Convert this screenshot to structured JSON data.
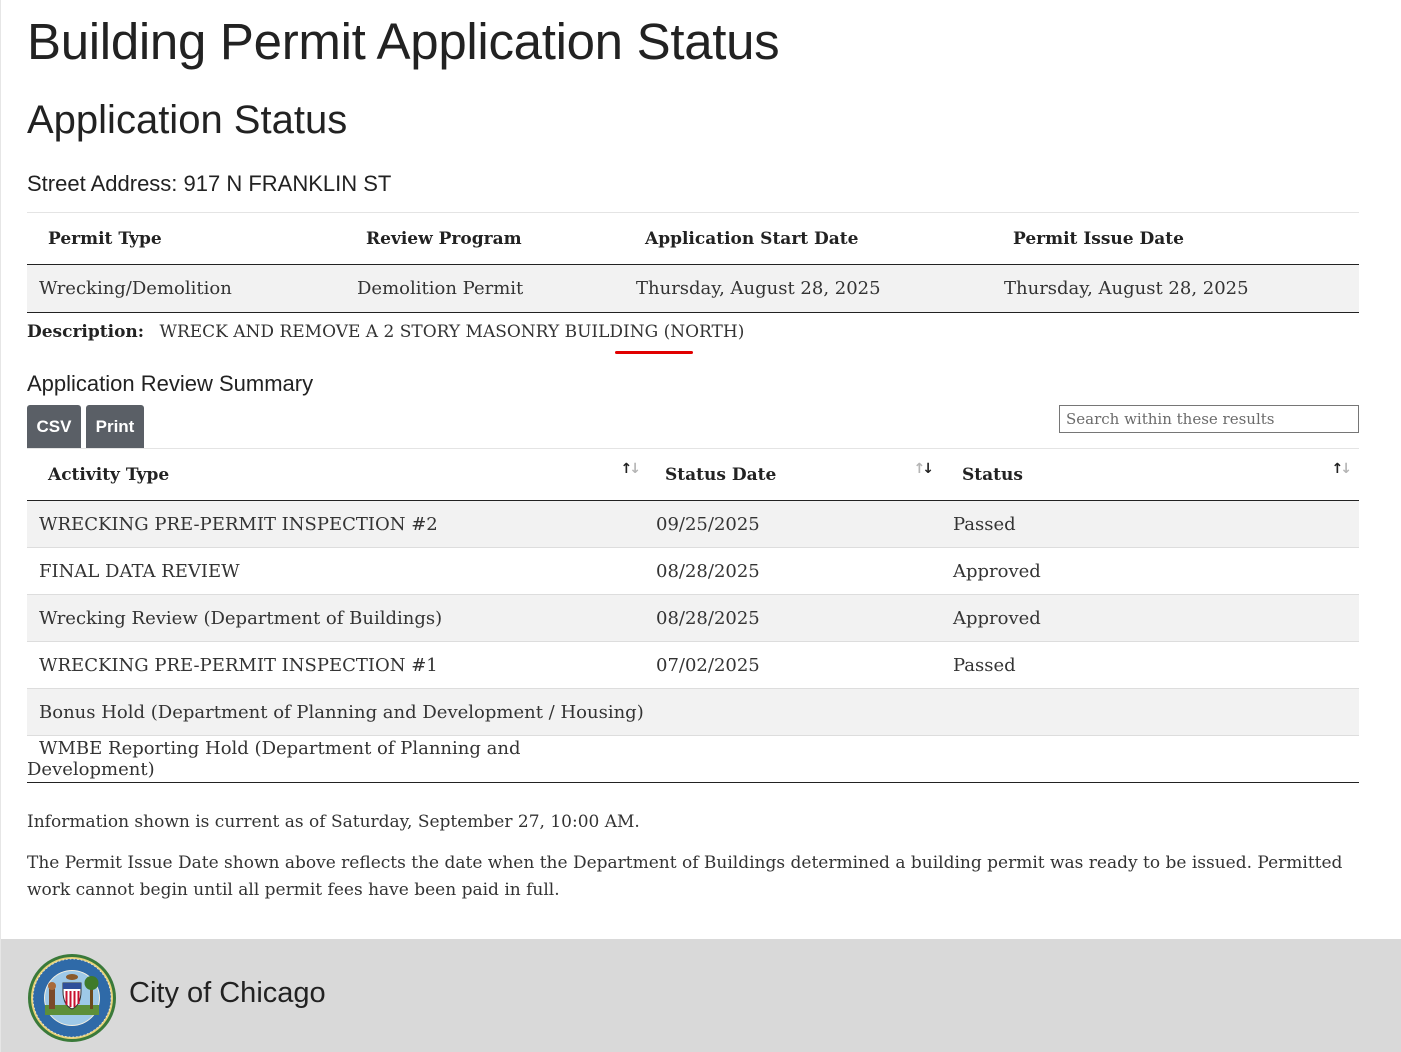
{
  "page": {
    "title": "Building Permit Application Status",
    "subtitle": "Application Status",
    "street_address": "Street Address: 917 N FRANKLIN ST"
  },
  "permit": {
    "headers": [
      "Permit Type",
      "Review Program",
      "Application Start Date",
      "Permit Issue Date"
    ],
    "row": [
      "Wrecking/Demolition",
      "Demolition Permit",
      "Thursday, August 28, 2025",
      "Thursday, August 28, 2025"
    ],
    "description_label": "Description:",
    "description": "WRECK AND REMOVE A 2 STORY MASONRY BUILDING (NORTH)"
  },
  "review": {
    "title": "Application Review Summary",
    "csv_label": "CSV",
    "print_label": "Print",
    "search_placeholder": "Search within these results",
    "headers": [
      "Activity Type",
      "Status Date",
      "Status"
    ],
    "rows": [
      [
        "WRECKING PRE-PERMIT INSPECTION #2",
        "09/25/2025",
        "Passed"
      ],
      [
        "FINAL DATA REVIEW",
        "08/28/2025",
        "Approved"
      ],
      [
        "Wrecking Review (Department of Buildings)",
        "08/28/2025",
        "Approved"
      ],
      [
        "WRECKING PRE-PERMIT INSPECTION #1",
        "07/02/2025",
        "Passed"
      ],
      [
        "Bonus Hold (Department of Planning and Development / Housing)",
        "",
        ""
      ],
      [
        "WMBE Reporting Hold (Department of Planning and Development)",
        "",
        ""
      ]
    ]
  },
  "notes": {
    "current_as_of": "Information shown is current as of Saturday, September 27, 10:00 AM.",
    "issue_date_note": "The Permit Issue Date shown above reflects the date when the Department of Buildings determined a building permit was ready to be issued. Permitted work cannot begin until all permit fees have been paid in full."
  },
  "footer": {
    "title": "City of Chicago",
    "seal_icon": "city-seal-icon"
  },
  "colors": {
    "button_bg": "#5a5f66",
    "row_stripe": "#f2f2f2",
    "footer_bg": "#d9d9d9",
    "annotation_red": "#e10000"
  }
}
